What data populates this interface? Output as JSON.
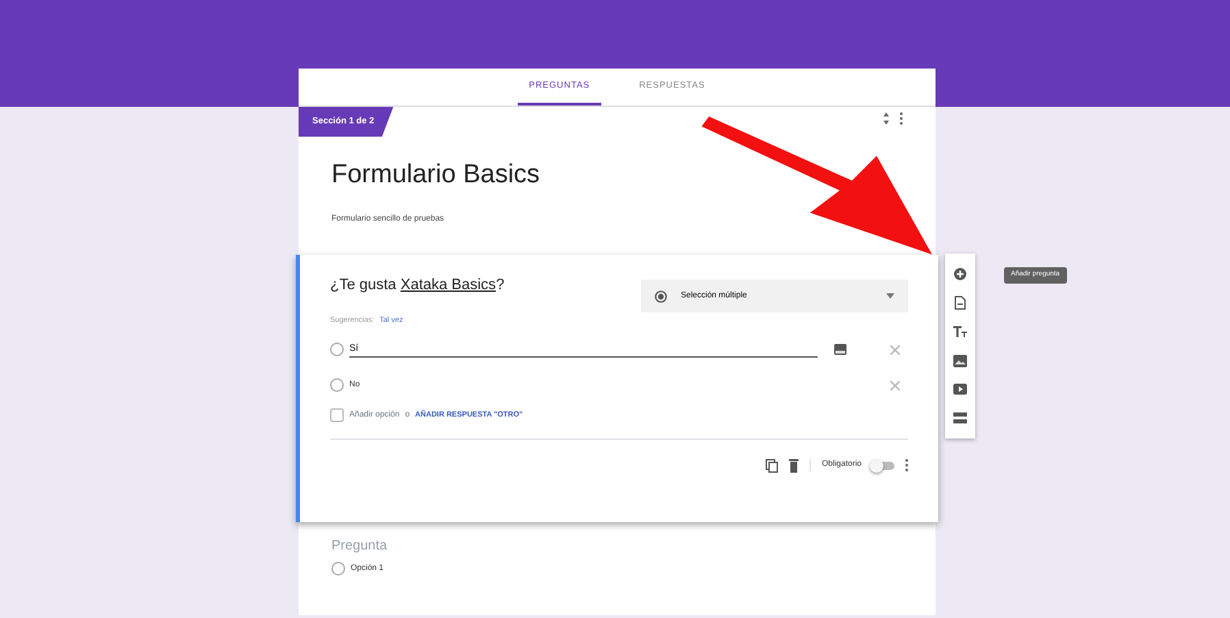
{
  "tabs": [
    {
      "label": "PREGUNTAS",
      "selected": true
    },
    {
      "label": "RESPUESTAS",
      "selected": false
    }
  ],
  "section": {
    "badge": "Sección 1 de 2",
    "title": "Formulario Basics",
    "description": "Formulario sencillo de pruebas"
  },
  "question": {
    "title": "¿Te gusta **Xataka Basics**?",
    "type": "Selección múltiple",
    "suggestions_label": "Sugerencias:",
    "suggestion": "Tal vez",
    "options": [
      {
        "kind": "editing",
        "value": "Sí",
        "selected": false
      },
      {
        "kind": "option",
        "label": "No",
        "selected": false
      }
    ],
    "add_option": "Añadir opción",
    "add_joiner": "o",
    "add_other": "AÑADIR RESPUESTA \"OTRO\"",
    "required_label": "Obligatorio",
    "required": false
  },
  "next_question": {
    "placeholder": "Pregunta",
    "options": [
      {
        "label": "Opción 1",
        "selected": false
      }
    ]
  },
  "tooltip": "Añadir pregunta"
}
